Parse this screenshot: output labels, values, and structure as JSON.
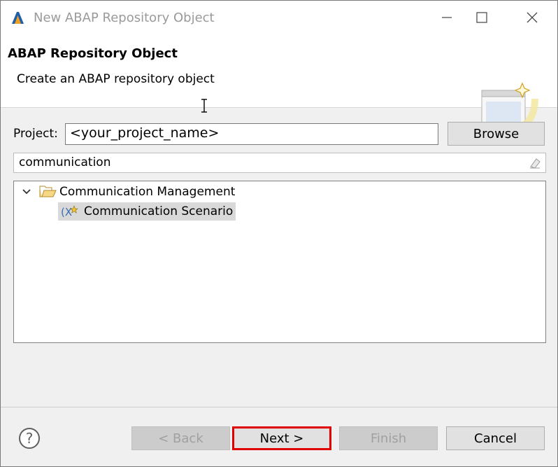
{
  "window": {
    "title": "New ABAP Repository Object",
    "minimize_icon": "minimize-icon",
    "maximize_icon": "maximize-icon",
    "close_icon": "close-icon"
  },
  "header": {
    "title": "ABAP Repository Object",
    "description": "Create an ABAP repository object"
  },
  "project": {
    "label": "Project:",
    "value": "<your_project_name>",
    "browse_label": "Browse"
  },
  "filter": {
    "value": "communication",
    "clear_icon": "clear-filter-icon"
  },
  "tree": {
    "items": [
      {
        "label": "Communication Management",
        "icon": "folder-open-icon",
        "expanded": true,
        "level": 0
      },
      {
        "label": "Communication Scenario",
        "icon": "communication-scenario-icon",
        "selected": true,
        "level": 1
      }
    ]
  },
  "footer": {
    "help_icon": "help-icon",
    "back_label": "< Back",
    "next_label": "Next >",
    "finish_label": "Finish",
    "cancel_label": "Cancel"
  },
  "colors": {
    "highlight_border": "#e00000",
    "selection_bg": "#d9d9d9"
  }
}
